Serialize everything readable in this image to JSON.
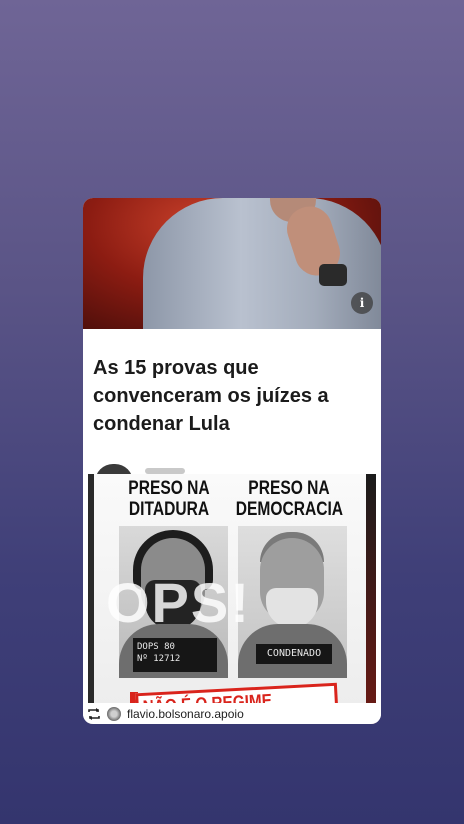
{
  "article": {
    "headline": "As 15 provas que convenceram os juízes a condenar Lula",
    "info_label": "i"
  },
  "poster": {
    "left_caption": "PRESO NA DITADURA",
    "right_caption": "PRESO NA DEMOCRACIA",
    "left_plate_line1": "DOPS     80",
    "left_plate_line2": "Nº 12712",
    "right_plate": "CONDENADO",
    "overlay_text": "OPS!",
    "banner_text": "NÃO É O REGIME, MESMO!"
  },
  "attribution": {
    "handle": "flavio.bolsonaro.apoio",
    "icons": [
      "repost-icon",
      "seal-icon"
    ]
  },
  "colors": {
    "accent_red": "#d9241c",
    "background_top": "#6f6596",
    "background_bottom": "#34356e"
  }
}
